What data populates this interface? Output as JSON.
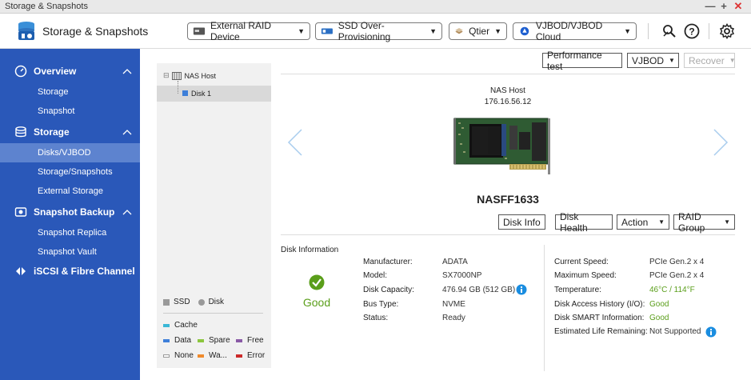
{
  "window": {
    "title": "Storage & Snapshots",
    "controls": [
      "—",
      "+",
      "✕"
    ]
  },
  "header": {
    "app_title": "Storage & Snapshots",
    "buttons": [
      {
        "label": "External RAID Device",
        "icon": "raid-device-icon"
      },
      {
        "label": "SSD Over-Provisioning",
        "icon": "ssd-icon"
      },
      {
        "label": "Qtier",
        "icon": "qtier-icon"
      },
      {
        "label": "VJBOD/VJBOD Cloud",
        "icon": "vjbod-cloud-icon"
      }
    ],
    "icons": [
      "search-settings-icon",
      "help-icon",
      "gear-icon"
    ]
  },
  "sidebar": {
    "groups": [
      {
        "label": "Overview",
        "icon": "overview-icon",
        "items": [
          "Storage",
          "Snapshot"
        ]
      },
      {
        "label": "Storage",
        "icon": "storage-icon",
        "items": [
          "Disks/VJBOD",
          "Storage/Snapshots",
          "External Storage"
        ]
      },
      {
        "label": "Snapshot Backup",
        "icon": "snapshot-backup-icon",
        "items": [
          "Snapshot Replica",
          "Snapshot Vault"
        ]
      },
      {
        "label": "iSCSI & Fibre Channel",
        "icon": "iscsi-icon",
        "items": []
      }
    ],
    "active_item": "Disks/VJBOD"
  },
  "tree": {
    "root": "NAS Host",
    "child": "Disk 1",
    "legend_type": [
      "SSD",
      "Disk"
    ],
    "legend_status": [
      {
        "label": "Cache",
        "color": "#3bb7d6"
      },
      {
        "label": "Data",
        "color": "#3e7fd9"
      },
      {
        "label": "Spare",
        "color": "#8cc63e"
      },
      {
        "label": "Free",
        "color": "#8a5aa6"
      },
      {
        "label": "None",
        "color": "#ffffff"
      },
      {
        "label": "Wa...",
        "color": "#f08a2c"
      },
      {
        "label": "Error",
        "color": "#cc2a2a"
      }
    ]
  },
  "toolbar": {
    "performance_test": "Performance test",
    "vjbod": "VJBOD",
    "recover": "Recover"
  },
  "device": {
    "host_name": "NAS Host",
    "host_ip": "176.16.56.12",
    "model_name": "NASFF1633"
  },
  "actions": {
    "disk_info": "Disk Info",
    "disk_health": "Disk Health",
    "action": "Action",
    "raid_group": "RAID Group"
  },
  "disk_information": {
    "section_title": "Disk Information",
    "status_word": "Good",
    "left": [
      {
        "label": "Manufacturer:",
        "value": "ADATA"
      },
      {
        "label": "Model:",
        "value": "SX7000NP"
      },
      {
        "label": "Disk Capacity:",
        "value": "476.94 GB (512 GB)"
      },
      {
        "label": "Bus Type:",
        "value": "NVME"
      },
      {
        "label": "Status:",
        "value": "Ready"
      }
    ],
    "right": [
      {
        "label": "Current Speed:",
        "value": "PCIe Gen.2 x 4"
      },
      {
        "label": "Maximum Speed:",
        "value": "PCIe Gen.2 x 4"
      },
      {
        "label": "Temperature:",
        "value": "46°C / 114°F"
      },
      {
        "label": "Disk Access History (I/O):",
        "value": "Good"
      },
      {
        "label": "Disk SMART Information:",
        "value": "Good"
      },
      {
        "label": "Estimated Life Remaining:",
        "value": "Not Supported"
      }
    ]
  },
  "colors": {
    "sidebar_bg": "#2a58b9",
    "sidebar_active": "#5d83cf",
    "good_green": "#5a9e1a",
    "info_blue": "#1a8de0"
  }
}
